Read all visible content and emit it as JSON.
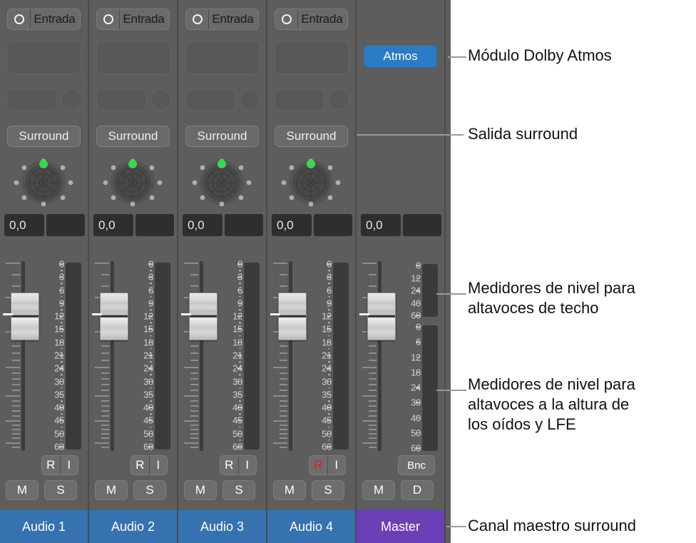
{
  "colors": {
    "panel_bg": "#5d5d5d",
    "audio_name_bg": "#3672b0",
    "master_name_bg": "#6b3fb5",
    "atmos_blue": "#2b7cc6",
    "record_red": "#e01f1f",
    "pan_puck_green": "#3ad84f",
    "meter_bg": "#3b3b3b"
  },
  "channels": [
    {
      "name": "Audio 1",
      "type": "audio",
      "input_label": "Entrada",
      "output_label": "Surround",
      "pan_value": "0,0",
      "pan_value_b": "",
      "rec_label": "R",
      "input_monitor_label": "I",
      "rec_enabled": false,
      "mute_label": "M",
      "solo_label": "S"
    },
    {
      "name": "Audio 2",
      "type": "audio",
      "input_label": "Entrada",
      "output_label": "Surround",
      "pan_value": "0,0",
      "pan_value_b": "",
      "rec_label": "R",
      "input_monitor_label": "I",
      "rec_enabled": false,
      "mute_label": "M",
      "solo_label": "S"
    },
    {
      "name": "Audio 3",
      "type": "audio",
      "input_label": "Entrada",
      "output_label": "Surround",
      "pan_value": "0,0",
      "pan_value_b": "",
      "rec_label": "R",
      "input_monitor_label": "I",
      "rec_enabled": false,
      "mute_label": "M",
      "solo_label": "S"
    },
    {
      "name": "Audio 4",
      "type": "audio",
      "input_label": "Entrada",
      "output_label": "Surround",
      "pan_value": "0,0",
      "pan_value_b": "",
      "rec_label": "R",
      "input_monitor_label": "I",
      "rec_enabled": true,
      "mute_label": "M",
      "solo_label": "S"
    },
    {
      "name": "Master",
      "type": "master",
      "plugin_label": "Atmos",
      "pan_value": "0,0",
      "pan_value_b": "",
      "bounce_label": "Bnc",
      "mute_label": "M",
      "dim_label": "D"
    }
  ],
  "meter_scales": {
    "channel": [
      "0",
      "3",
      "6",
      "9",
      "12",
      "15",
      "18",
      "21",
      "24",
      "30",
      "35",
      "40",
      "45",
      "50",
      "60"
    ],
    "master_top": [
      "0",
      "12",
      "24",
      "40",
      "60"
    ],
    "master_bottom": [
      "0",
      "6",
      "12",
      "18",
      "24",
      "30",
      "40",
      "50",
      "60"
    ]
  },
  "annotations": [
    {
      "id": "atmos-plugin",
      "text": "Módulo Dolby Atmos"
    },
    {
      "id": "surround-output",
      "text": "Salida surround"
    },
    {
      "id": "ceiling-meters",
      "text": "Medidores de nivel para\naltavoces de techo"
    },
    {
      "id": "ear-level-meters",
      "text": "Medidores de nivel para\naltavoces a la altura de\nlos oídos y LFE"
    },
    {
      "id": "master-channel",
      "text": "Canal maestro surround"
    }
  ]
}
